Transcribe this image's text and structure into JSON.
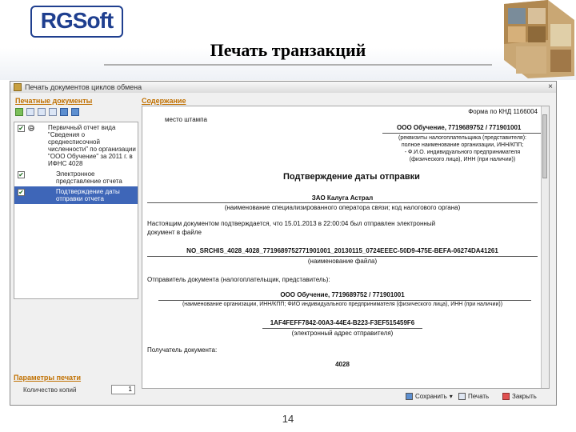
{
  "slide": {
    "logo_text": "RGSoft",
    "title": "Печать транзакций",
    "page_number": "14"
  },
  "window": {
    "title": "Печать документов циклов обмена",
    "close_label": "×"
  },
  "left_panel": {
    "section_title": "Печатные документы",
    "items": [
      {
        "text": "Первичный отчет вида \"Сведения о среднесписочной численности\" по организации \"ООО Обучение\" за 2011 г. в ИФНС 4028",
        "checked": true,
        "expander": "⊖"
      },
      {
        "text": "Электронное представление отчета",
        "checked": true
      },
      {
        "text": "Подтверждение даты отправки отчета",
        "checked": true,
        "selected": true
      }
    ],
    "params_title": "Параметры печати",
    "copies_label": "Количество копий",
    "copies_value": "1"
  },
  "content": {
    "section_title": "Содержание",
    "form_code": "Форма по КНД 1166004",
    "stamp_place": "место штампа",
    "org_line": "ООО Обучение, 7719689752 / 771901001",
    "org_caption": [
      "(реквизиты налогоплательщика (представителя):",
      "полное наименование организации, ИНН/КПП;",
      "- Ф.И.О. индивидуального предпринимателя",
      "(физического лица), ИНН (при наличии))"
    ],
    "doc_title": "Подтверждение даты отправки",
    "operator": "ЗАО Калуга Астрал",
    "operator_caption": "(наименование специализированного оператора связи; код налогового органа)",
    "confirm_text_1": "Настоящим документом подтверждается, что 15.01.2013 в 22:00:04 был отправлен электронный",
    "confirm_text_2": "документ в файле",
    "file_name": "NO_SRCHIS_4028_4028_7719689752771901001_20130115_0724EEEC-50D9-475E-BEFA-06274DA41261",
    "file_caption": "(наименование файла)",
    "sender_label": "Отправитель документа (налогоплательщик, представитель):",
    "sender_org": "ООО Обучение, 7719689752 / 771901001",
    "sender_caption": "(наименование организации, ИНН/КПП; ФИО индивидуального предпринимателя (физического лица), ИНН (при наличии))",
    "guid": "1AF4FEFF7842-00A3-44E4-B223-F3EF515459F6",
    "guid_caption": "(электронный адрес отправителя)",
    "receiver_label": "Получатель документа:",
    "receiver_code": "4028"
  },
  "bottom_bar": {
    "save_label": "Сохранить",
    "print_label": "Печать",
    "close_label": "Закрыть"
  }
}
